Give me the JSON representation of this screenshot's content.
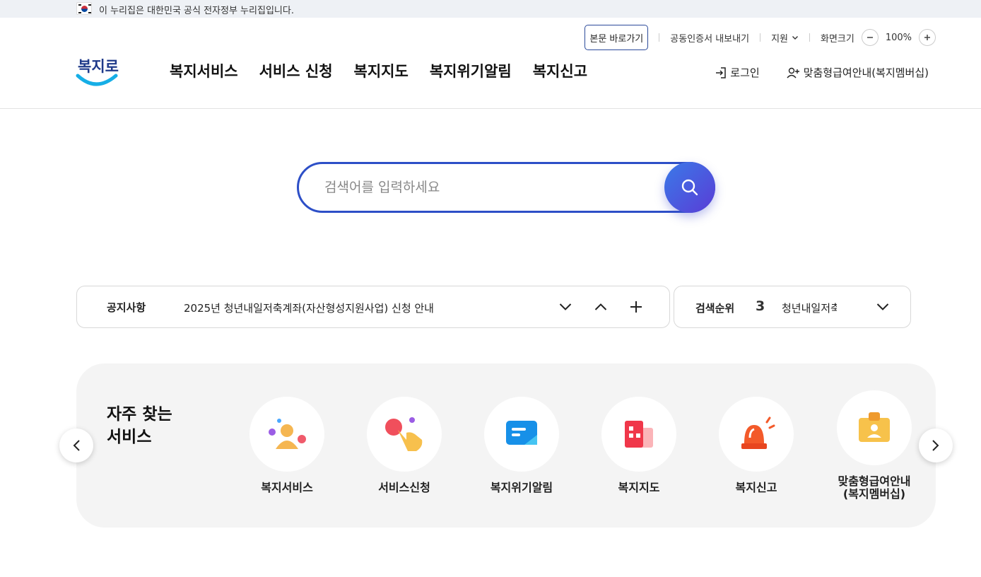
{
  "gov_banner": {
    "text": "이 누리집은 대한민국 공식 전자정부 누리집입니다."
  },
  "utility": {
    "skip_link": "본문 바로가기",
    "cert_export": "공동인증서 내보내기",
    "support": "지원",
    "screen_size": "화면크기",
    "zoom_level": "100%"
  },
  "logo": {
    "text": "복지로"
  },
  "gnb": {
    "items": [
      "복지서비스",
      "서비스 신청",
      "복지지도",
      "복지위기알림",
      "복지신고"
    ]
  },
  "account": {
    "login": "로그인",
    "membership": "맞춤형급여안내(복지멤버십)"
  },
  "search": {
    "placeholder": "검색어를 입력하세요"
  },
  "notice": {
    "label": "공지사항",
    "message": "2025년 청년내일저축계좌(자산형성지원사업) 신청 안내"
  },
  "rank": {
    "label": "검색순위",
    "number": "3",
    "keyword": "청년내일저축계좌"
  },
  "frequent": {
    "title": "자주 찾는\n서비스",
    "items": [
      {
        "label": "복지서비스",
        "icon": "person-icon"
      },
      {
        "label": "서비스신청",
        "icon": "hand-tap-icon"
      },
      {
        "label": "복지위기알림",
        "icon": "message-icon"
      },
      {
        "label": "복지지도",
        "icon": "building-icon"
      },
      {
        "label": "복지신고",
        "icon": "siren-icon"
      },
      {
        "label": "맞춤형급여안내\n(복지멤버십)",
        "icon": "id-badge-icon"
      }
    ]
  },
  "colors": {
    "primary": "#2d4fc7",
    "accent_gradient_end": "#5a3cd6",
    "panel_bg": "#f4f4f4"
  }
}
